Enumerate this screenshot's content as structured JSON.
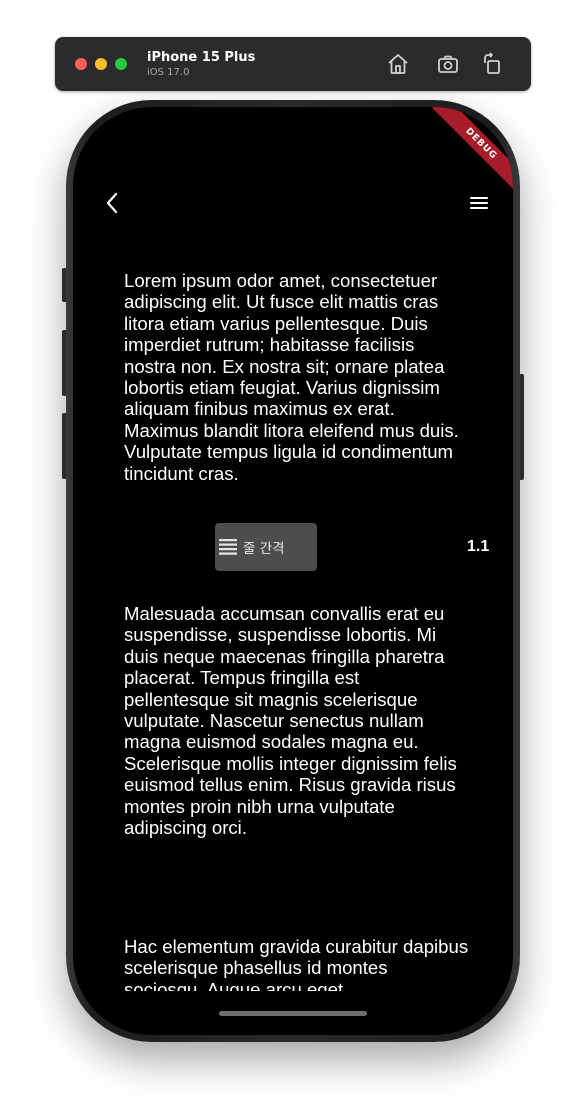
{
  "simulator": {
    "device_name": "iPhone 15 Plus",
    "os_version": "iOS 17.0",
    "icons": [
      "home-icon",
      "screenshot-icon",
      "rotate-icon"
    ]
  },
  "debug_banner": "DEBUG",
  "nav": {
    "back_icon": "chevron-left-icon",
    "menu_icon": "hamburger-menu-icon"
  },
  "paragraphs": [
    "Lorem ipsum odor amet, consectetuer adipiscing elit. Ut fusce elit mattis cras litora etiam varius pellentesque. Duis imperdiet rutrum; habitasse facilisis nostra non. Ex nostra sit; ornare platea lobortis etiam feugiat. Varius dignissim aliquam finibus maximus ex erat. Maximus blandit litora eleifend mus duis. Vulputate tempus ligula id condimentum tincidunt cras.",
    "Malesuada accumsan convallis erat eu suspendisse, suspendisse lobortis. Mi duis neque maecenas fringilla pharetra placerat. Tempus fringilla est pellentesque sit magnis scelerisque vulputate. Nascetur senectus nullam magna euismod sodales magna eu. Scelerisque mollis integer dignissim felis euismod tellus enim. Risus gravida risus montes proin nibh urna vulputate adipiscing orci.",
    "Hac elementum gravida curabitur dapibus scelerisque phasellus id montes sociosqu. Augue arcu eget"
  ],
  "line_spacing": {
    "label": "줄 간격",
    "icon": "line-spacing-icon",
    "value": "1.1"
  },
  "colors": {
    "screen_background": "#000000",
    "text": "#ffffff",
    "chip_background": "#4d4d4d",
    "debug_banner": "#a71d2a"
  }
}
